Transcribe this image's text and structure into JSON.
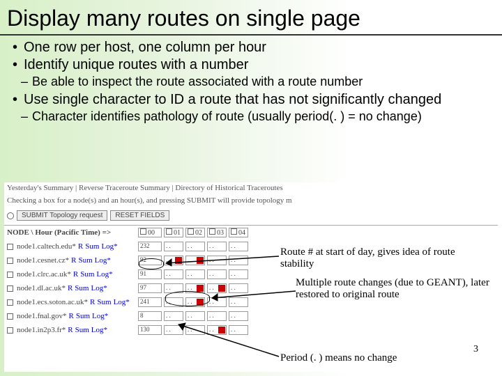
{
  "title": "Display many routes on single page",
  "bullets": {
    "b1": "One row per host, one column per hour",
    "b2": "Identify unique routes with a number",
    "b2a": "Be able to inspect the route associated with a route number",
    "b3": "Use single character to ID a route that has not significantly changed",
    "b3a": "Character identifies pathology of route (usually period(. ) = no change)"
  },
  "shot": {
    "topbar": "Yesterday's Summary | Reverse Traceroute Summary | Directory of Historical Traceroutes",
    "note": "Checking a box for a node(s) and an hour(s), and pressing SUBMIT will provide topology m",
    "submit": "SUBMIT Topology request",
    "reset": "RESET FIELDS",
    "nodeHdr": "NODE \\ Hour (Pacific Time) =>",
    "hours": [
      "00",
      "01",
      "02",
      "03",
      "04"
    ],
    "rows": [
      {
        "host": "node1.caltech.edu*",
        "first": "232",
        "cells": [
          "",
          "",
          "",
          ""
        ]
      },
      {
        "host": "node1.cesnet.cz*",
        "first": "92",
        "cells": [
          "r",
          "r",
          "",
          ""
        ]
      },
      {
        "host": "node1.clrc.ac.uk*",
        "first": "91",
        "cells": [
          "",
          "",
          "",
          ""
        ]
      },
      {
        "host": "node1.dl.ac.uk*",
        "first": "97",
        "cells": [
          "",
          "r",
          "r",
          ""
        ]
      },
      {
        "host": "node1.ecs.soton.ac.uk*",
        "first": "241",
        "cells": [
          "",
          "r",
          "",
          ""
        ]
      },
      {
        "host": "node1.fnal.gov*",
        "first": "8",
        "cells": [
          "",
          "",
          "",
          ""
        ]
      },
      {
        "host": "node1.in2p3.fr*",
        "first": "130",
        "cells": [
          "",
          "",
          "r",
          ""
        ]
      }
    ],
    "linkR": "R",
    "linkSum": "Sum",
    "linkLog": "Log*"
  },
  "annot": {
    "a1": "Route # at start of day, gives idea of route stability",
    "a2": "Multiple route changes  (due to GEANT), later restored to original route",
    "a3": "Period (. ) means no change"
  },
  "pagenum": "3"
}
